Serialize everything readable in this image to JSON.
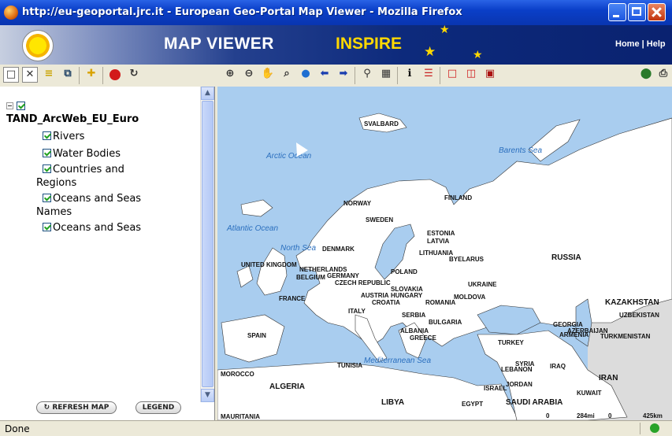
{
  "window": {
    "title": "http://eu-geoportal.jrc.it - European Geo-Portal Map Viewer - Mozilla Firefox"
  },
  "banner": {
    "title": "MAP VIEWER",
    "brand": "INSPIRE",
    "links": "Home | Help"
  },
  "layers": {
    "group": "TAND_ArcWeb_EU_Euro",
    "items": [
      {
        "line1": "Rivers",
        "line2": ""
      },
      {
        "line1": "Water Bodies",
        "line2": ""
      },
      {
        "line1": "Countries and",
        "line2": "Regions"
      },
      {
        "line1": "Oceans and Seas",
        "line2": "Names"
      },
      {
        "line1": "Oceans and Seas",
        "line2": ""
      }
    ]
  },
  "buttons": {
    "refresh": "↻ REFRESH MAP",
    "legend": "LEGEND"
  },
  "map_labels": {
    "svalbard": "SVALBARD",
    "barents": "Barents Sea",
    "arctic": "Arctic Ocean",
    "atlantic": "Atlantic Ocean",
    "north_sea": "North Sea",
    "med": "Mediterranean Sea",
    "finland": "FINLAND",
    "norway": "NORWAY",
    "sweden": "SWEDEN",
    "estonia": "ESTONIA",
    "latvia": "LATVIA",
    "lithuania": "LITHUANIA",
    "belarus": "BYELARUS",
    "denmark": "DENMARK",
    "uk": "UNITED KINGDOM",
    "netherlands": "NETHERLANDS",
    "belgium": "BELGIUM",
    "germany": "GERMANY",
    "poland": "POLAND",
    "czech": "CZECH REPUBLIC",
    "slovakia": "SLOVAKIA",
    "austria": "AUSTRIA",
    "hungary": "HUNGARY",
    "moldova": "MOLDOVA",
    "ukraine": "UKRAINE",
    "russia": "RUSSIA",
    "france": "FRANCE",
    "croatia": "CROATIA",
    "romania": "ROMANIA",
    "serbia": "SERBIA",
    "bulgaria": "BULGARIA",
    "italy": "ITALY",
    "albania": "ALBANIA",
    "greece": "GREECE",
    "spain": "SPAIN",
    "turkey": "TURKEY",
    "georgia": "GEORGIA",
    "azerbaijan": "AZERBAIJAN",
    "armenia": "ARMENIA",
    "turkmenistan": "TURKMENISTAN",
    "kazakhstan": "KAZAKHSTAN",
    "uzbekistan": "UZBEKISTAN",
    "syria": "SYRIA",
    "lebanon": "LEBANON",
    "iraq": "IRAQ",
    "iran": "IRAN",
    "israel": "ISRAEL",
    "jordan": "JORDAN",
    "kuwait": "KUWAIT",
    "saudi": "SAUDI ARABIA",
    "egypt": "EGYPT",
    "libya": "LIBYA",
    "tunisia": "TUNISIA",
    "algeria": "ALGERIA",
    "morocco": "MOROCCO",
    "mauritania": "MAURITANIA",
    "scale1": "0",
    "scale2": "284mi",
    "scale3": "0",
    "scale4": "425km"
  },
  "status": {
    "text": "Done"
  },
  "colors": {
    "land": "#ffffff",
    "sea": "#a9cdef",
    "non_eu_land": "#dcdcdc",
    "title_bar": "#0a3fc8"
  }
}
